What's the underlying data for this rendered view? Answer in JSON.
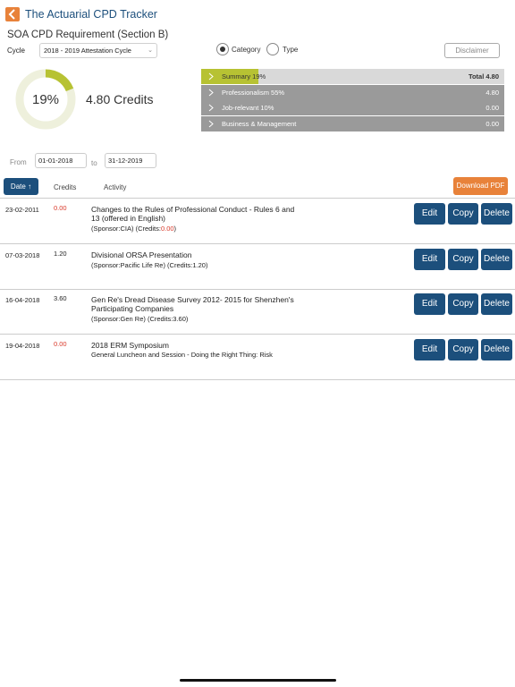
{
  "app": {
    "title": "The Actuarial CPD Tracker"
  },
  "section_title": "SOA CPD Requirement (Section B)",
  "cycle": {
    "label": "Cycle",
    "selected": "2018 - 2019 Attestation Cycle"
  },
  "view_toggle": {
    "category_label": "Category",
    "type_label": "Type",
    "selected": "Category"
  },
  "disclaimer_label": "Disclaimer",
  "progress": {
    "percent_label": "19%",
    "fraction": 0.19,
    "credits_label": "4.80 Credits"
  },
  "summary": [
    {
      "label": "Summary 19%",
      "value": "Total 4.80",
      "fill": 0.19
    },
    {
      "label": "Professionalism 55%",
      "value": "4.80"
    },
    {
      "label": "Job-relevant 10%",
      "value": "0.00"
    },
    {
      "label": "Business & Management",
      "value": "0.00"
    }
  ],
  "filter": {
    "from_label": "From",
    "from_value": "01-01-2018",
    "to_label": "to",
    "to_value": "31-12-2019"
  },
  "columns": {
    "date_label": "Date",
    "credits_label": "Credits",
    "activity_label": "Activity"
  },
  "download_label": "Download PDF",
  "actions": {
    "edit": "Edit",
    "copy": "Copy",
    "delete": "Delete"
  },
  "entries": [
    {
      "date": "23-02-2011",
      "credits": "0.00",
      "title": "Changes to the Rules of Professional Conduct - Rules 6 and 13 (offered in English)",
      "sponsor_prefix": "(Sponsor:CIA) (Credits:",
      "sponsor_credits": "0.00",
      "sponsor_suffix": ")"
    },
    {
      "date": "07-03-2018",
      "credits": "1.20",
      "title": "Divisional ORSA Presentation",
      "sponsor_prefix": "(Sponsor:Pacific Life Re) (Credits:",
      "sponsor_credits": "1.20",
      "sponsor_suffix": ")"
    },
    {
      "date": "16-04-2018",
      "credits": "3.60",
      "title": "Gen Re's Dread Disease Survey 2012- 2015 for Shenzhen's Participating Companies",
      "sponsor_prefix": "(Sponsor:Gen Re) (Credits:",
      "sponsor_credits": "3.60",
      "sponsor_suffix": ")"
    },
    {
      "date": "19-04-2018",
      "credits": "0.00",
      "title": "2018 ERM Symposium",
      "subtitle": "General Luncheon and Session - Doing the Right Thing: Risk"
    }
  ],
  "colors": {
    "brand": "#1c4f7c",
    "accent": "#e8823a",
    "progress": "#b7c233",
    "zero_credit": "#d93a2b"
  }
}
